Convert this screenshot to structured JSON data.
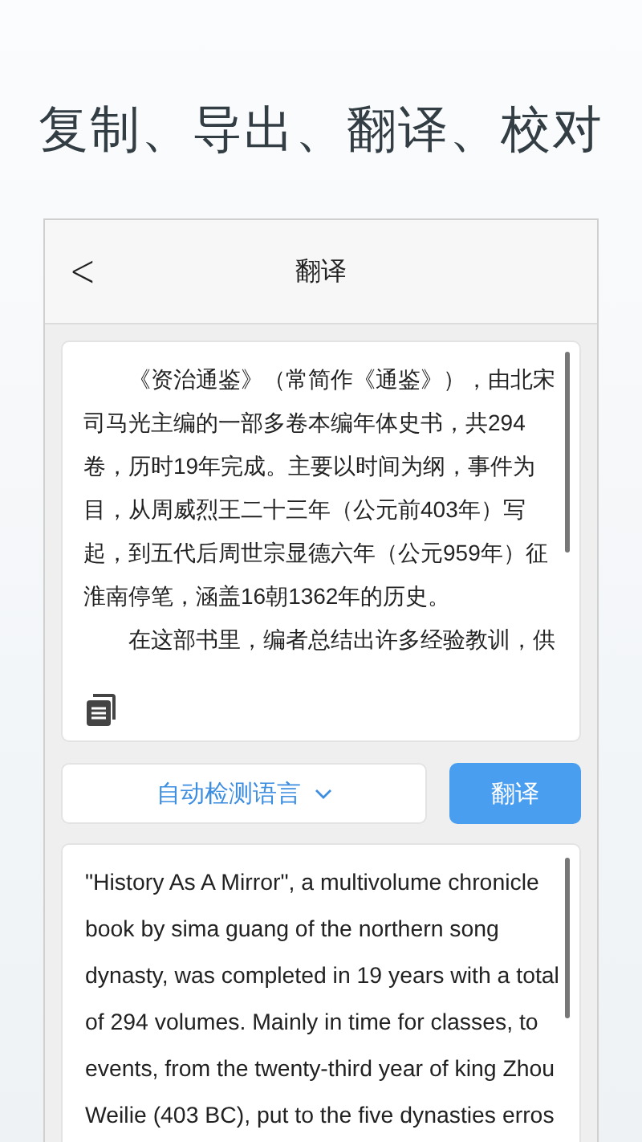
{
  "headline": "复制、导出、翻译、校对",
  "screen": {
    "title": "翻译",
    "back": "<"
  },
  "source": {
    "paragraphs": [
      "《资治通鉴》（常简作《通鉴》），由北宋司马光主编的一部多卷本编年体史书，共294卷，历时19年完成。主要以时间为纲，事件为目，从周威烈王二十三年（公元前403年）写起，到五代后周世宗显德六年（公元959年）征淮南停笔，涵盖16朝1362年的历史。",
      "在这部书里，编者总结出许多经验教训，供"
    ]
  },
  "language_button": "自动检测语言",
  "translate_button": "翻译",
  "result": {
    "text": "\"History As A Mirror\", a multivolume chronicle book by sima guang of the northern song dynasty, was completed in 19 years with a total of 294 volumes. Mainly in time for classes, to events, from the twenty-third year of king Zhou Weilie (403 BC), put to the five dynasties erros"
  }
}
